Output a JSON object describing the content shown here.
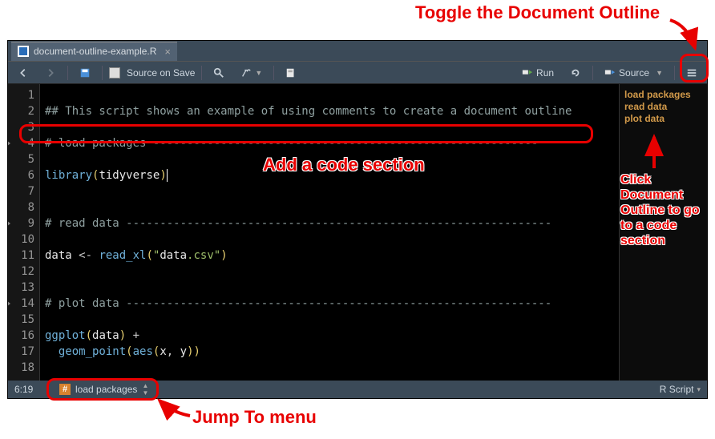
{
  "tab": {
    "filename": "document-outline-example.R"
  },
  "toolbar": {
    "source_on_save": "Source on Save",
    "run": "Run",
    "source": "Source"
  },
  "code": {
    "lines": [
      "",
      "## This script shows an example of using comments to create a document outline",
      "",
      "# load packages ---------------------------------------------------------",
      "",
      "library(tidyverse)",
      "",
      "",
      "# read data ---------------------------------------------------------------",
      "",
      "data <- read_xl(\"data.csv\")",
      "",
      "",
      "# plot data ---------------------------------------------------------------",
      "",
      "ggplot(data) +",
      "  geom_point(aes(x, y))",
      ""
    ],
    "fold_lines": [
      4,
      9,
      14
    ]
  },
  "outline": {
    "items": [
      "load packages",
      "read data",
      "plot data"
    ]
  },
  "status": {
    "position": "6:19",
    "jump_label": "load packages",
    "language": "R Script"
  },
  "annotations": {
    "toggle": "Toggle the Document Outline",
    "add_section": "Add a code section",
    "click_outline": "Click Document Outline to go to a code section",
    "jump_menu": "Jump To menu"
  }
}
